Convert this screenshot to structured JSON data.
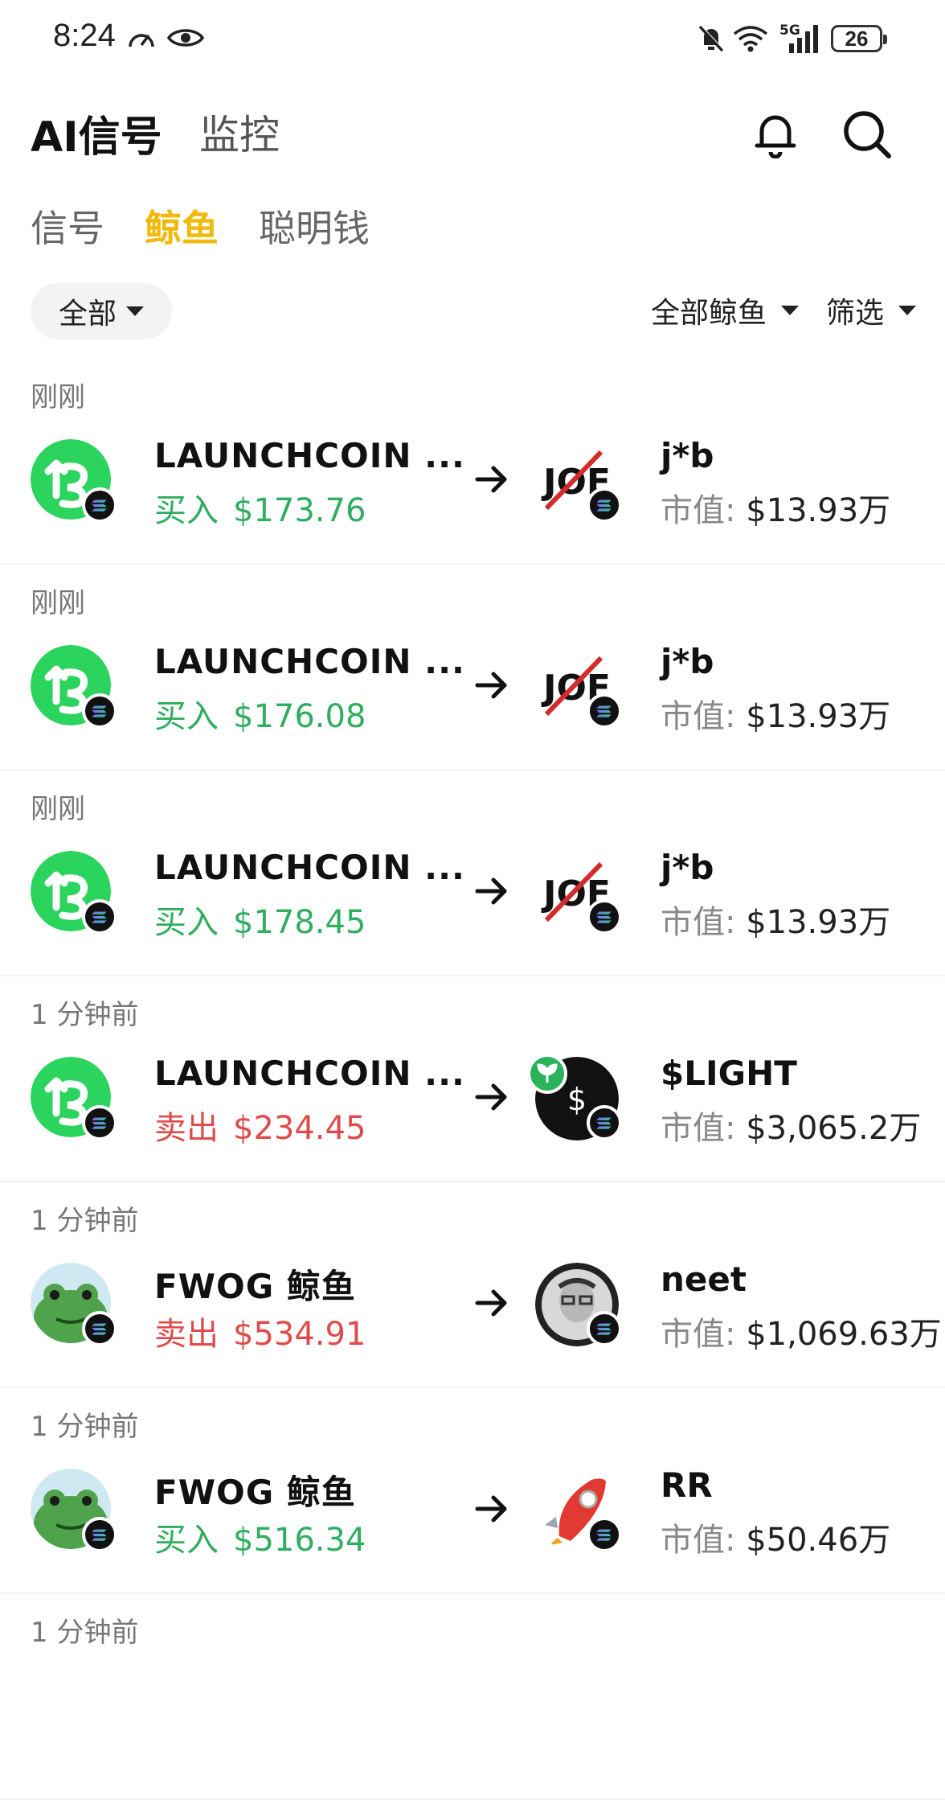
{
  "status_bar": {
    "time": "8:24",
    "network": "5G",
    "battery": "26"
  },
  "header": {
    "title": "AI信号",
    "subtitle": "监控"
  },
  "tabs": [
    {
      "label": "信号",
      "active": false
    },
    {
      "label": "鲸鱼",
      "active": true
    },
    {
      "label": "聪明钱",
      "active": false
    }
  ],
  "filters": {
    "scope": "全部",
    "whale_filter": "全部鲸鱼",
    "filter": "筛选"
  },
  "colors": {
    "accent": "#f0b90b",
    "buy": "#2eae5e",
    "sell": "#e04a4a"
  },
  "feed": [
    {
      "time": "刚刚",
      "name": "LAUNCHCOIN ...",
      "action": "买入",
      "side": "buy",
      "amount": "$173.76",
      "token": "j*b",
      "mcap_label": "市值:",
      "mcap": "$13.93万",
      "token_icon": "joe-icon",
      "whale_icon": "launchcoin-icon"
    },
    {
      "time": "刚刚",
      "name": "LAUNCHCOIN ...",
      "action": "买入",
      "side": "buy",
      "amount": "$176.08",
      "token": "j*b",
      "mcap_label": "市值:",
      "mcap": "$13.93万",
      "token_icon": "joe-icon",
      "whale_icon": "launchcoin-icon"
    },
    {
      "time": "刚刚",
      "name": "LAUNCHCOIN ...",
      "action": "买入",
      "side": "buy",
      "amount": "$178.45",
      "token": "j*b",
      "mcap_label": "市值:",
      "mcap": "$13.93万",
      "token_icon": "joe-icon",
      "whale_icon": "launchcoin-icon"
    },
    {
      "time": "1 分钟前",
      "name": "LAUNCHCOIN ...",
      "action": "卖出",
      "side": "sell",
      "amount": "$234.45",
      "token": "$LIGHT",
      "mcap_label": "市值:",
      "mcap": "$3,065.2万",
      "token_icon": "dollar-coin-icon",
      "whale_icon": "launchcoin-icon"
    },
    {
      "time": "1 分钟前",
      "name": "FWOG 鲸鱼",
      "action": "卖出",
      "side": "sell",
      "amount": "$534.91",
      "token": "neet",
      "mcap_label": "市值:",
      "mcap": "$1,069.63万",
      "token_icon": "neet-avatar-icon",
      "whale_icon": "fwog-frog-icon"
    },
    {
      "time": "1 分钟前",
      "name": "FWOG 鲸鱼",
      "action": "买入",
      "side": "buy",
      "amount": "$516.34",
      "token": "RR",
      "mcap_label": "市值:",
      "mcap": "$50.46万",
      "token_icon": "rocket-icon",
      "whale_icon": "fwog-frog-icon"
    },
    {
      "time": "1 分钟前"
    }
  ]
}
